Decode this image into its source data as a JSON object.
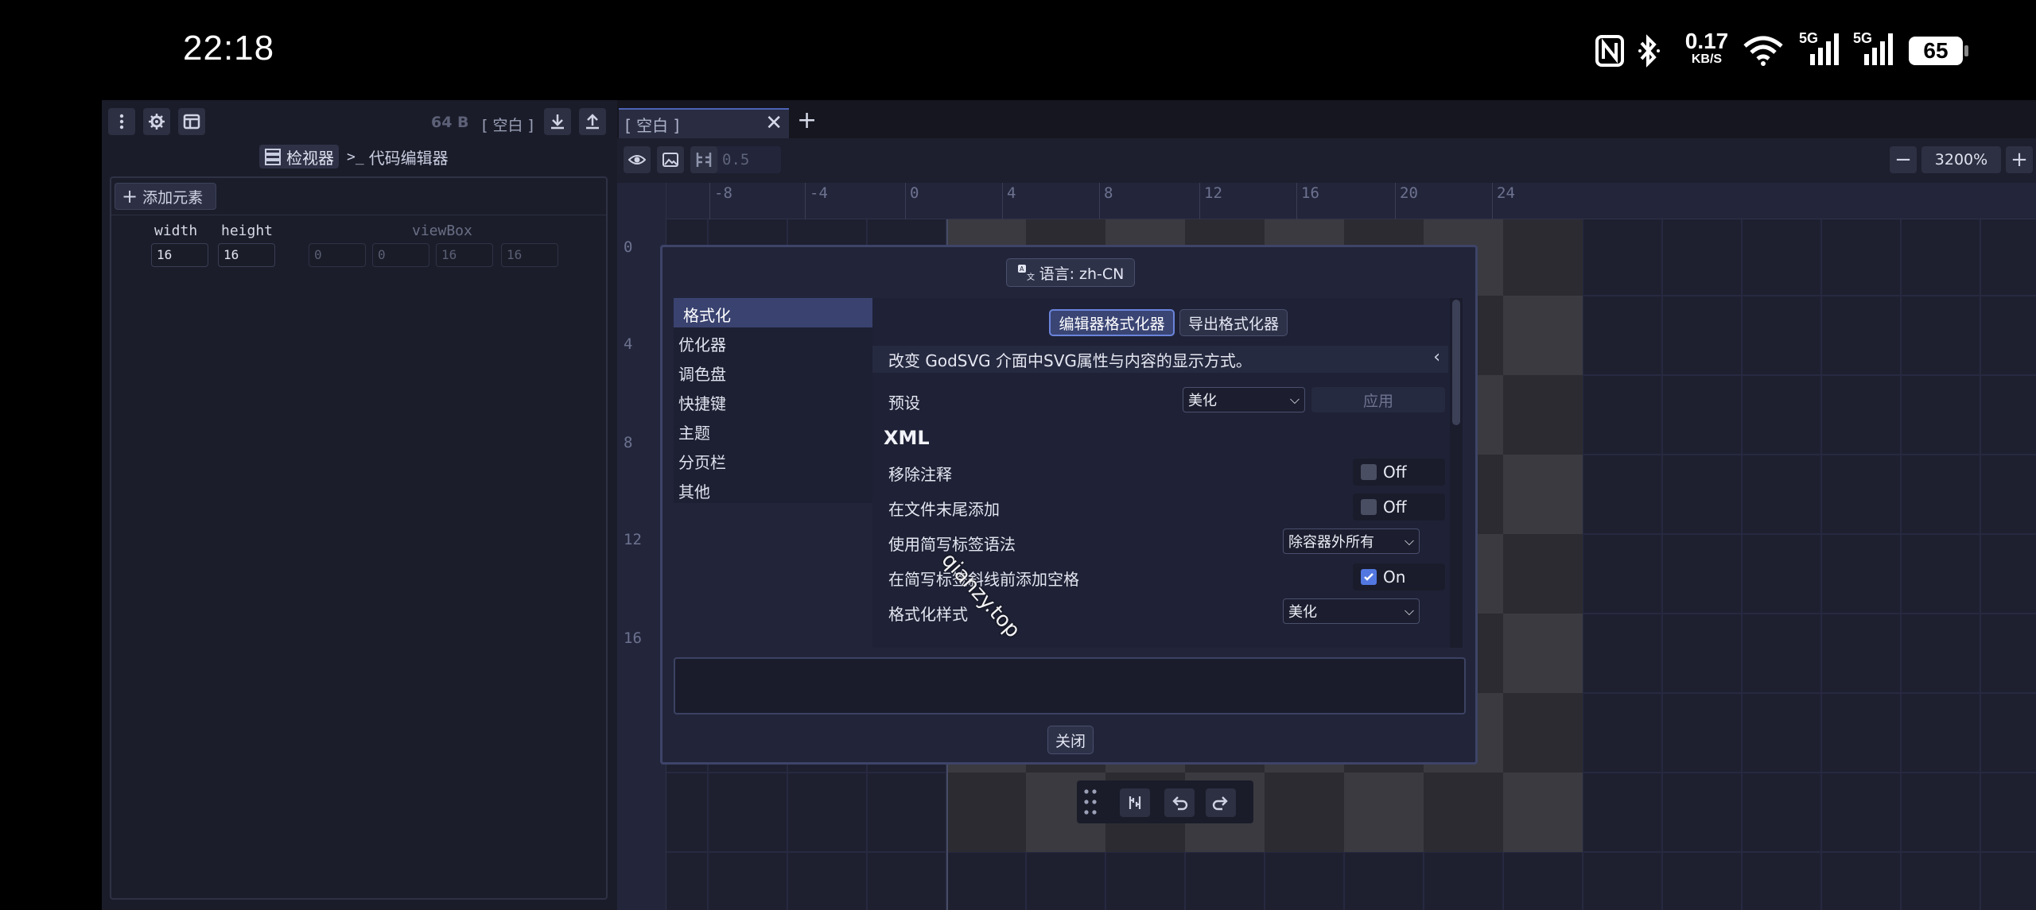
{
  "status_bar": {
    "time": "22:18",
    "net_speed_value": "0.17",
    "net_speed_unit": "KB/S",
    "signal1": "5G",
    "signal2": "5G",
    "battery": "65",
    "icons": [
      "nfc-icon",
      "bluetooth-icon",
      "wifi-icon",
      "signal-5g-icon",
      "signal-5g-icon",
      "battery-icon"
    ]
  },
  "left_panel": {
    "file_size": "64 B",
    "file_name": "[ 空白 ]",
    "view_tabs": {
      "inspector": "检视器",
      "code_editor": "代码编辑器"
    },
    "add_element": "添加元素",
    "attrs": {
      "width_label": "width",
      "height_label": "height",
      "viewbox_label": "viewBox",
      "width": "16",
      "height": "16",
      "viewbox": [
        "0",
        "0",
        "16",
        "16"
      ]
    }
  },
  "canvas": {
    "tab_title": "[ 空白 ]",
    "snap_value": "0.5",
    "zoom": "3200%",
    "ruler_top": [
      "-8",
      "-4",
      "0",
      "4",
      "8",
      "12",
      "16",
      "20",
      "24"
    ],
    "ruler_left": [
      "0",
      "4",
      "8",
      "12",
      "16"
    ]
  },
  "dialog": {
    "language_button": "语言: zh-CN",
    "nav": [
      "格式化",
      "优化器",
      "调色盘",
      "快捷键",
      "主题",
      "分页栏",
      "其他"
    ],
    "selected_nav": "格式化",
    "sub_tabs": [
      "编辑器格式化器",
      "导出格式化器"
    ],
    "description": "改变 GodSVG 介面中SVG属性与内容的显示方式。",
    "preset_label": "预设",
    "preset_value": "美化",
    "apply_label": "应用",
    "section_xml": "XML",
    "rows": [
      {
        "label": "移除注释",
        "type": "toggle",
        "value": "Off"
      },
      {
        "label": "在文件末尾添加",
        "type": "toggle",
        "value": "Off"
      },
      {
        "label": "使用简写标签语法",
        "type": "select",
        "value": "除容器外所有"
      },
      {
        "label": "在简写标签斜线前添加空格",
        "type": "toggle",
        "value": "On"
      },
      {
        "label": "格式化样式",
        "type": "select",
        "value": "美化"
      }
    ],
    "close_label": "关闭"
  },
  "watermark": "qianzy.top",
  "colors": {
    "accent": "#5277e0",
    "dialog_bg": "#22253a",
    "selected_nav": "#3a4270"
  }
}
